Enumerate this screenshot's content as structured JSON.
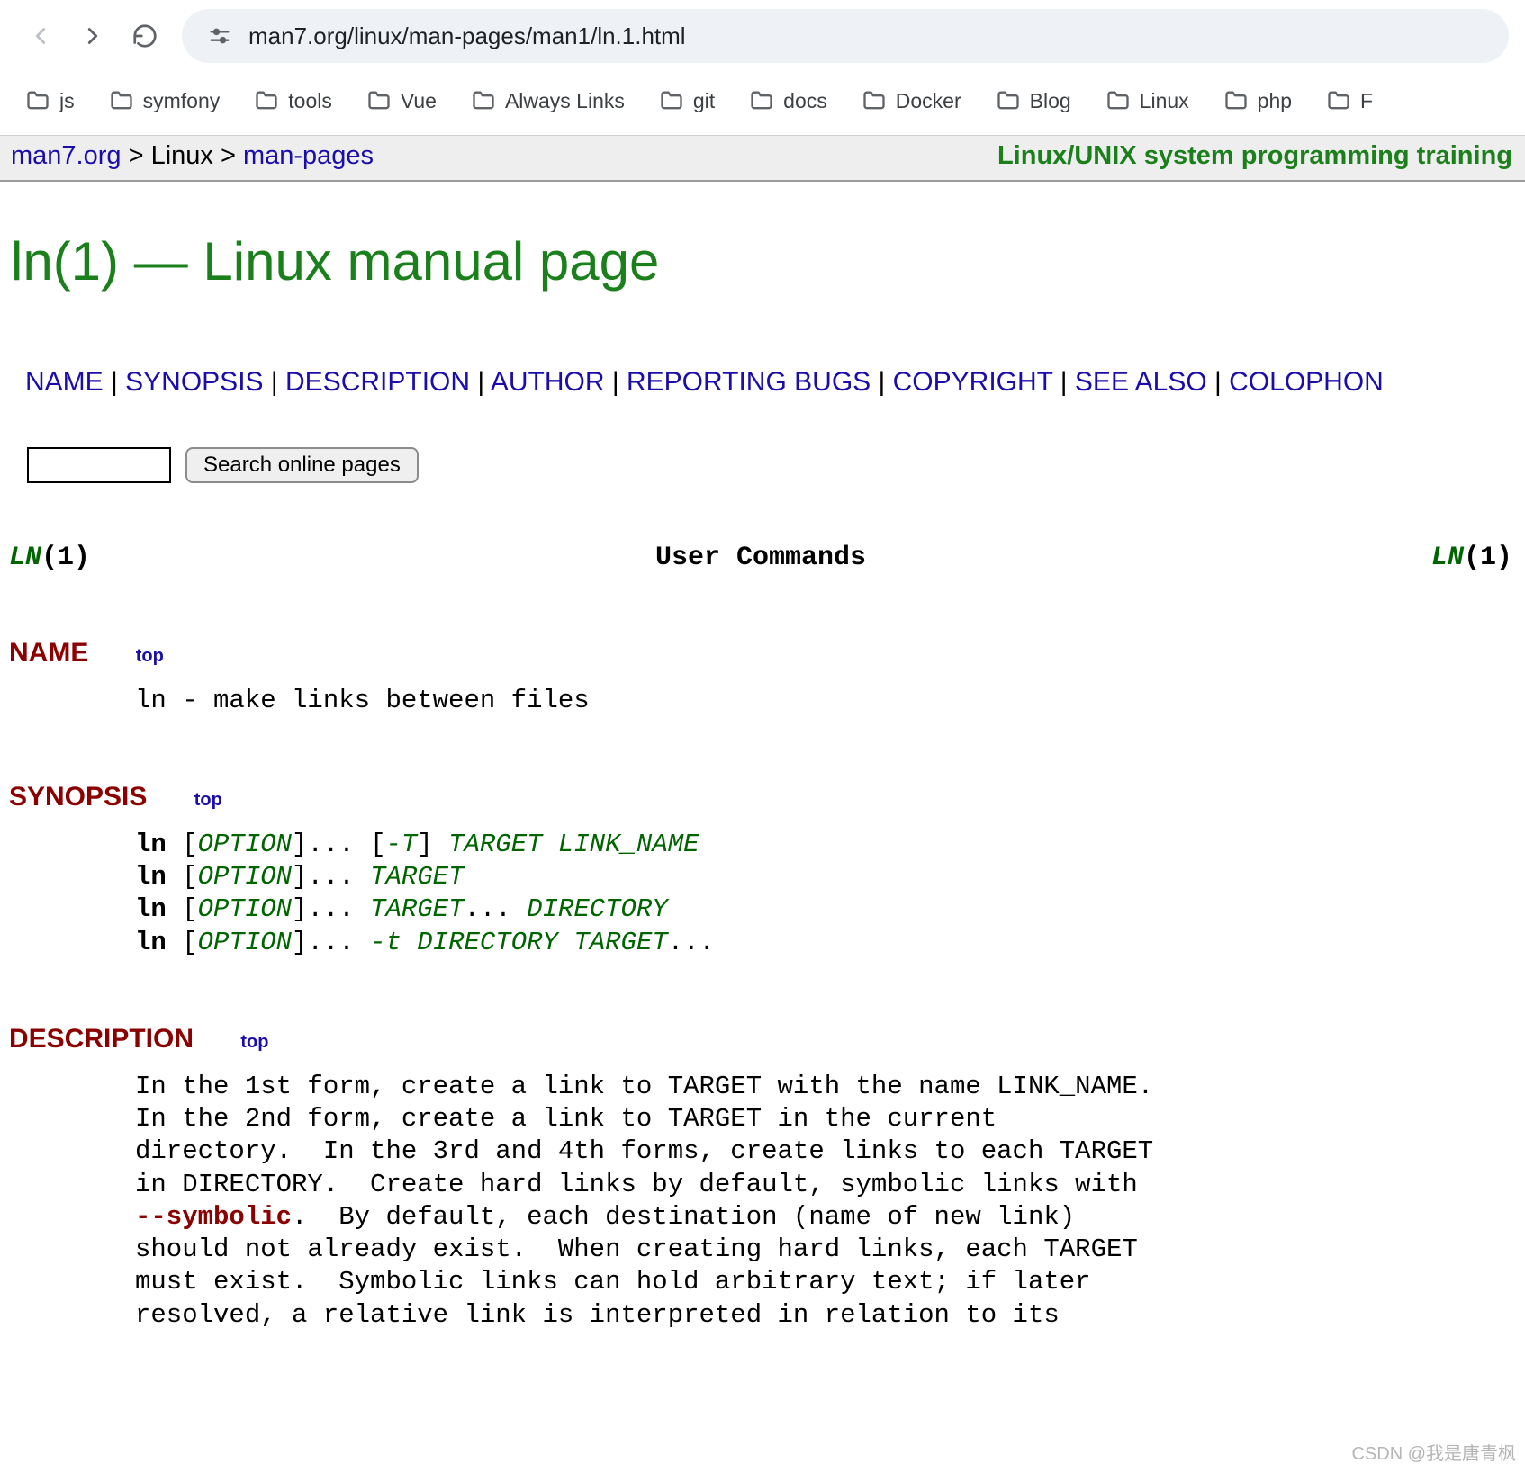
{
  "browser": {
    "url": "man7.org/linux/man-pages/man1/ln.1.html",
    "bookmarks": [
      {
        "label": "js"
      },
      {
        "label": "symfony"
      },
      {
        "label": "tools"
      },
      {
        "label": "Vue"
      },
      {
        "label": "Always Links"
      },
      {
        "label": "git"
      },
      {
        "label": "docs"
      },
      {
        "label": "Docker"
      },
      {
        "label": "Blog"
      },
      {
        "label": "Linux"
      },
      {
        "label": "php"
      },
      {
        "label": "F"
      }
    ]
  },
  "topbar": {
    "home": "man7.org",
    "sep": ">",
    "linux": "Linux",
    "manpages": "man-pages",
    "training": "Linux/UNIX system programming training"
  },
  "page_title": "ln(1) — Linux manual page",
  "nav": {
    "items": [
      "NAME",
      "SYNOPSIS",
      "DESCRIPTION",
      "AUTHOR",
      "REPORTING BUGS",
      "COPYRIGHT",
      "SEE ALSO",
      "COLOPHON"
    ]
  },
  "search": {
    "button": "Search online pages"
  },
  "header": {
    "left_cmd": "LN",
    "left_sect": "(1)",
    "center": "User Commands",
    "right_cmd": "LN",
    "right_sect": "(1)"
  },
  "sections": {
    "top_label": "top",
    "name": {
      "heading": "NAME",
      "text": "ln - make links between files"
    },
    "synopsis": {
      "heading": "SYNOPSIS",
      "lines": {
        "ln": "ln",
        "lb": " [",
        "option": "OPTION",
        "rb_ellips": "]... ",
        "lbT": "[",
        "dashT": "-T",
        "rbT": "] ",
        "target": "TARGET",
        "link_name": "LINK_NAME",
        "directory": "DIRECTORY",
        "dash_t": "-t",
        "ellips": "...",
        "sp": " "
      }
    },
    "description": {
      "heading": "DESCRIPTION",
      "p1a": "In the 1st form, create a link to TARGET with the name LINK_NAME.",
      "p1b": "In the 2nd form, create a link to TARGET in the current",
      "p1c": "directory.  In the 3rd and 4th forms, create links to each TARGET",
      "p1d": "in DIRECTORY.  Create hard links by default, symbolic links with",
      "symbolic": "--symbolic",
      "p1e": ".  By default, each destination (name of new link)",
      "p1f": "should not already exist.  When creating hard links, each TARGET",
      "p1g": "must exist.  Symbolic links can hold arbitrary text; if later",
      "p1h": "resolved, a relative link is interpreted in relation to its"
    }
  },
  "watermark": "CSDN @我是唐青枫"
}
